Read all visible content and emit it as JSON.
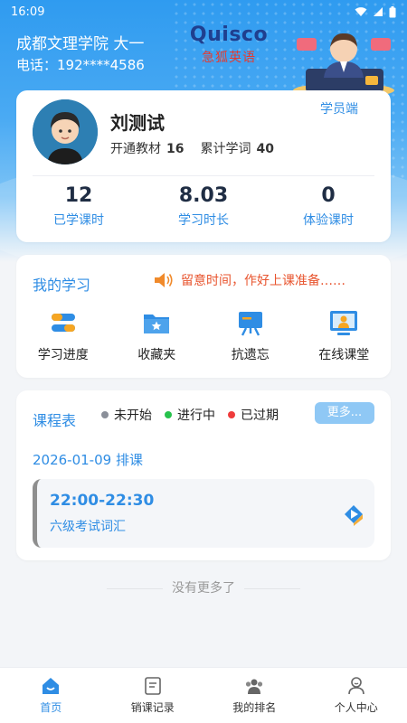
{
  "status_bar": {
    "time": "16:09"
  },
  "header": {
    "school": "成都文理学院 大一",
    "phone": "电话：192****4586",
    "brand_logo": "Quisco",
    "brand_sub": "急狐英语"
  },
  "profile": {
    "name": "刘测试",
    "role_link": "学员端",
    "books_label": "开通教材",
    "books_count": "16",
    "words_label": "累计学词",
    "words_count": "40",
    "metrics": [
      {
        "value": "12",
        "label": "已学课时"
      },
      {
        "value": "8.03",
        "label": "学习时长"
      },
      {
        "value": "0",
        "label": "体验课时"
      }
    ]
  },
  "study": {
    "title": "我的学习",
    "notice": "留意时间，作好上课准备……",
    "features": [
      {
        "label": "学习进度",
        "icon": "progress-icon"
      },
      {
        "label": "收藏夹",
        "icon": "favorites-folder-icon"
      },
      {
        "label": "抗遗忘",
        "icon": "review-board-icon"
      },
      {
        "label": "在线课堂",
        "icon": "online-class-icon"
      }
    ]
  },
  "schedule": {
    "title": "课程表",
    "legend": [
      {
        "label": "未开始",
        "color": "#8a8f99"
      },
      {
        "label": "进行中",
        "color": "#27c24c"
      },
      {
        "label": "已过期",
        "color": "#ef3b3b"
      }
    ],
    "more": "更多...",
    "date_line": "2026-01-09 排课",
    "lesson": {
      "time": "22:00-22:30",
      "name": "六级考试词汇"
    }
  },
  "footer_note": "没有更多了",
  "tabs": [
    {
      "label": "首页",
      "icon": "home-icon",
      "active": true
    },
    {
      "label": "销课记录",
      "icon": "record-icon",
      "active": false
    },
    {
      "label": "我的排名",
      "icon": "ranking-icon",
      "active": false
    },
    {
      "label": "个人中心",
      "icon": "profile-icon",
      "active": false
    }
  ],
  "colors": {
    "accent": "#2f8de4",
    "header": "#2f9bf0",
    "notice": "#e8542e"
  }
}
